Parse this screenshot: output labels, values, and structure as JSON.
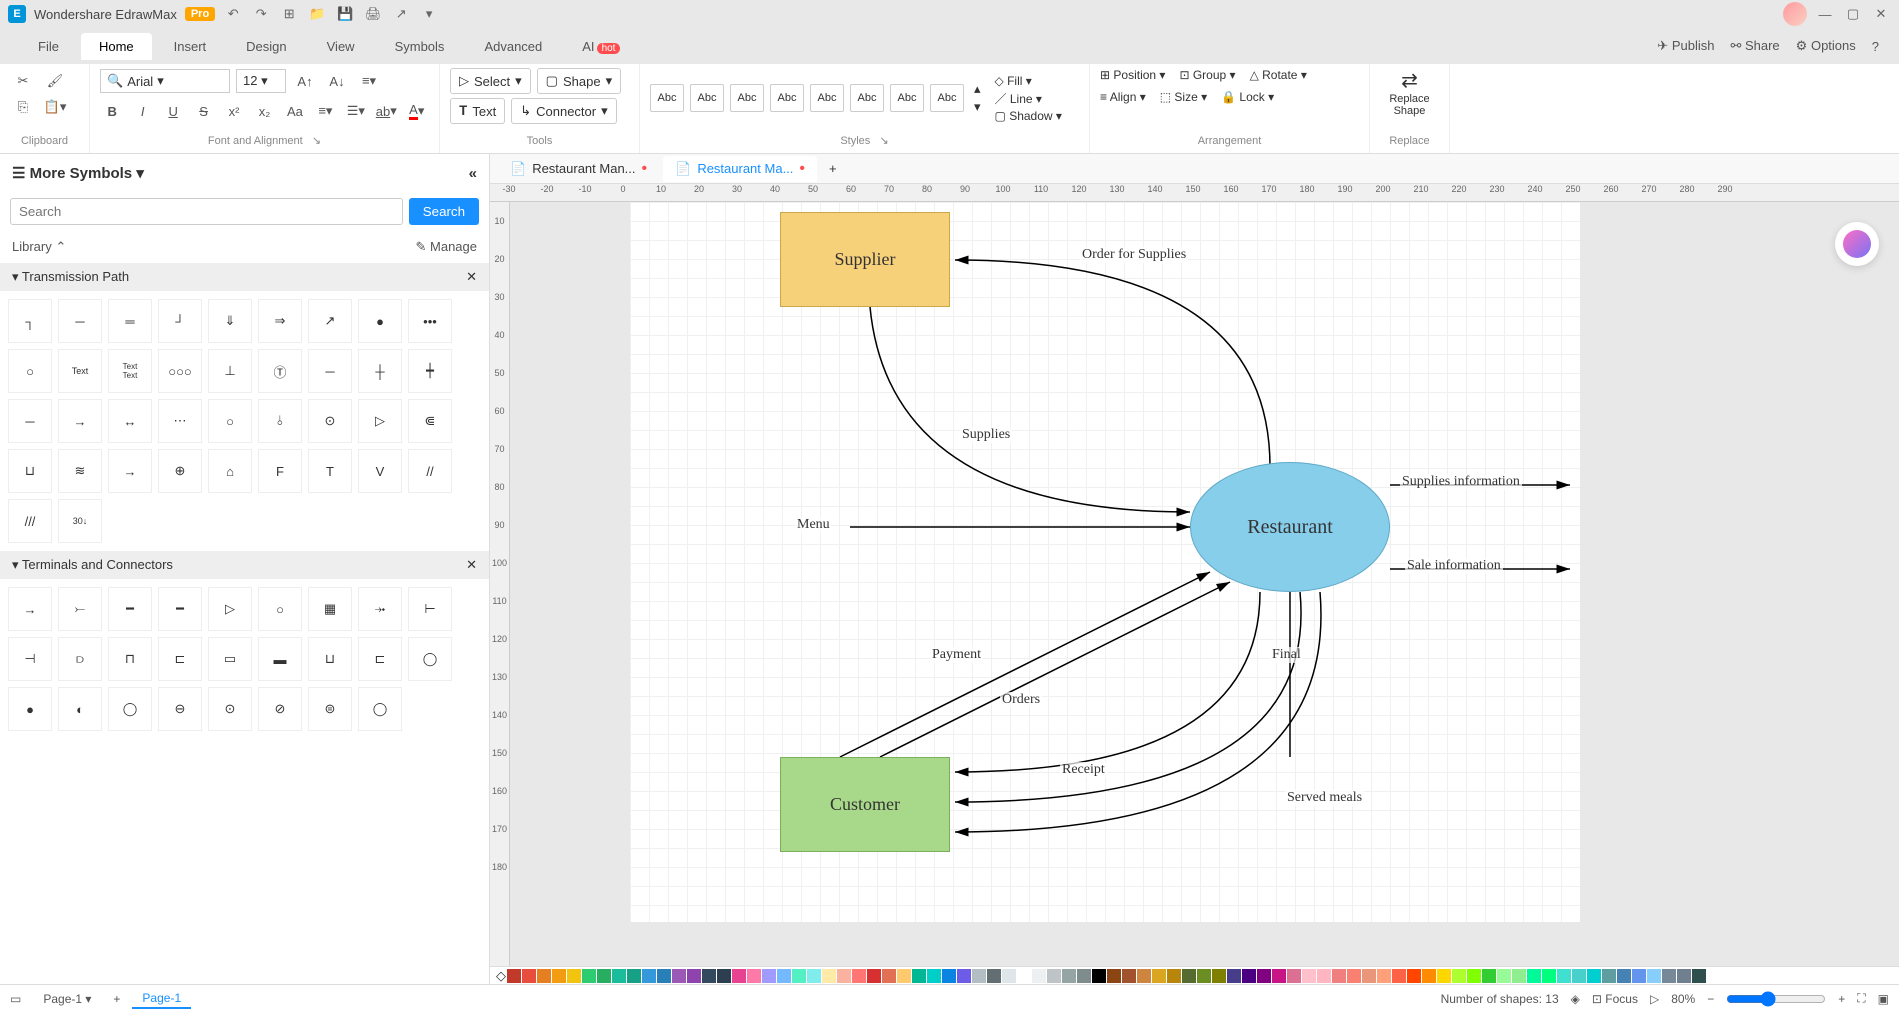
{
  "app": {
    "title": "Wondershare EdrawMax",
    "badge": "Pro"
  },
  "menus": [
    "File",
    "Home",
    "Insert",
    "Design",
    "View",
    "Symbols",
    "Advanced",
    "AI"
  ],
  "active_menu": "Home",
  "ai_hot": "hot",
  "menu_right": {
    "publish": "Publish",
    "share": "Share",
    "options": "Options"
  },
  "ribbon": {
    "clipboard": "Clipboard",
    "font_align": "Font and Alignment",
    "tools_label": "Tools",
    "styles_label": "Styles",
    "arrangement": "Arrangement",
    "replace": "Replace",
    "font": "Arial",
    "size": "12",
    "select": "Select",
    "text": "Text",
    "shape": "Shape",
    "connector": "Connector",
    "abc": "Abc",
    "fill": "Fill",
    "line": "Line",
    "shadow": "Shadow",
    "position": "Position",
    "align": "Align",
    "group": "Group",
    "size_btn": "Size",
    "rotate": "Rotate",
    "lock": "Lock",
    "replace_shape": "Replace\nShape"
  },
  "panel": {
    "title": "More Symbols",
    "search_placeholder": "Search",
    "search_btn": "Search",
    "library": "Library",
    "manage": "Manage",
    "cat1": "Transmission Path",
    "cat2": "Terminals and Connectors"
  },
  "tabs": [
    {
      "label": "Restaurant Man...",
      "active": false
    },
    {
      "label": "Restaurant Ma...",
      "active": true
    }
  ],
  "diagram": {
    "supplier": "Supplier",
    "customer": "Customer",
    "restaurant": "Restaurant",
    "menu": "Menu",
    "supplies_info": "Supplies information",
    "sale_info": "Sale information",
    "order_supplies": "Order for Supplies",
    "supplies": "Supplies",
    "payment": "Payment",
    "orders": "Orders",
    "final": "Final",
    "receipt": "Receipt",
    "served_meals": "Served meals"
  },
  "status": {
    "page": "Page-1",
    "page_active": "Page-1",
    "shapes": "Number of shapes: 13",
    "focus": "Focus",
    "zoom": "80%"
  },
  "colors": [
    "#c0392b",
    "#e74c3c",
    "#e67e22",
    "#f39c12",
    "#f1c40f",
    "#2ecc71",
    "#27ae60",
    "#1abc9c",
    "#16a085",
    "#3498db",
    "#2980b9",
    "#9b59b6",
    "#8e44ad",
    "#34495e",
    "#2c3e50",
    "#e84393",
    "#fd79a8",
    "#a29bfe",
    "#74b9ff",
    "#55efc4",
    "#81ecec",
    "#ffeaa7",
    "#fab1a0",
    "#ff7675",
    "#d63031",
    "#e17055",
    "#fdcb6e",
    "#00b894",
    "#00cec9",
    "#0984e3",
    "#6c5ce7",
    "#b2bec3",
    "#636e72",
    "#dfe6e9",
    "#ffffff",
    "#ecf0f1",
    "#bdc3c7",
    "#95a5a6",
    "#7f8c8d",
    "#000000",
    "#8b4513",
    "#a0522d",
    "#cd853f",
    "#daa520",
    "#b8860b",
    "#556b2f",
    "#6b8e23",
    "#808000",
    "#483d8b",
    "#4b0082",
    "#800080",
    "#c71585",
    "#db7093",
    "#ffc0cb",
    "#ffb6c1",
    "#f08080",
    "#fa8072",
    "#e9967a",
    "#ffa07a",
    "#ff6347",
    "#ff4500",
    "#ff8c00",
    "#ffd700",
    "#adff2f",
    "#7fff00",
    "#32cd32",
    "#98fb98",
    "#90ee90",
    "#00fa9a",
    "#00ff7f",
    "#40e0d0",
    "#48d1cc",
    "#00ced1",
    "#5f9ea0",
    "#4682b4",
    "#6495ed",
    "#87cefa",
    "#778899",
    "#708090",
    "#2f4f4f"
  ]
}
